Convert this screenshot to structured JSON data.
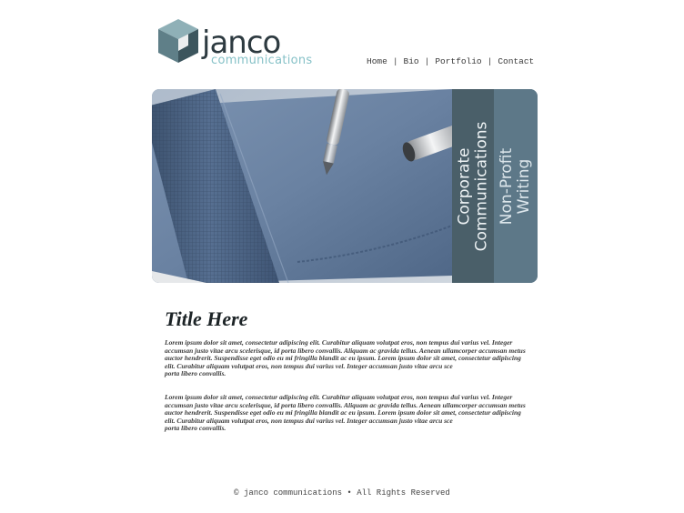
{
  "brand": {
    "name": "janco",
    "tagline": "communications"
  },
  "nav": {
    "items": [
      "Home",
      "Bio",
      "Portfolio",
      "Contact"
    ],
    "separator": "|"
  },
  "hero": {
    "image": "notebook-and-pen-photo",
    "tabs": [
      "Corporate\nCommunications",
      "Non-Profit\nWriting"
    ],
    "colors": {
      "tab_corporate": "#4a5f69",
      "tab_nonprofit": "#5d7888"
    }
  },
  "content": {
    "title": "Title Here",
    "paragraphs": [
      "Lorem ipsum dolor sit amet, consectetur adipiscing elit. Curabitur aliquam volutpat eros, non tempus dui varius vel. Integer accumsan justo vitae arcu scelerisque, id porta libero convallis. Aliquam ac gravida tellus. Aenean ullamcorper accumsan metus auctor hendrerit. Suspendisse eget odio eu mi fringilla blandit ac eu ipsum. Lorem ipsum dolor sit amet, consectetur adipiscing elit. Curabitur aliquam volutpat eros, non tempus dui varius vel. Integer accumsan justo vitae arcu sce\nporta libero convallis.",
      "Lorem ipsum dolor sit amet, consectetur adipiscing elit. Curabitur aliquam volutpat eros, non tempus dui varius vel. Integer accumsan justo vitae arcu scelerisque, id porta libero convallis. Aliquam ac gravida tellus. Aenean ullamcorper accumsan metus auctor hendrerit. Suspendisse eget odio eu mi fringilla blandit ac eu ipsum. Lorem ipsum dolor sit amet, consectetur adipiscing elit. Curabitur aliquam volutpat eros, non tempus dui varius vel. Integer accumsan justo vitae arcu sce\nporta libero convallis."
    ]
  },
  "footer": {
    "text": "© janco communications • All Rights Reserved"
  },
  "colors": {
    "logo_dark": "#2d3a40",
    "logo_accent": "#86c1c7",
    "cube_light": "#8fb0b7",
    "cube_mid": "#5f7f88",
    "cube_dark": "#3c555d"
  }
}
